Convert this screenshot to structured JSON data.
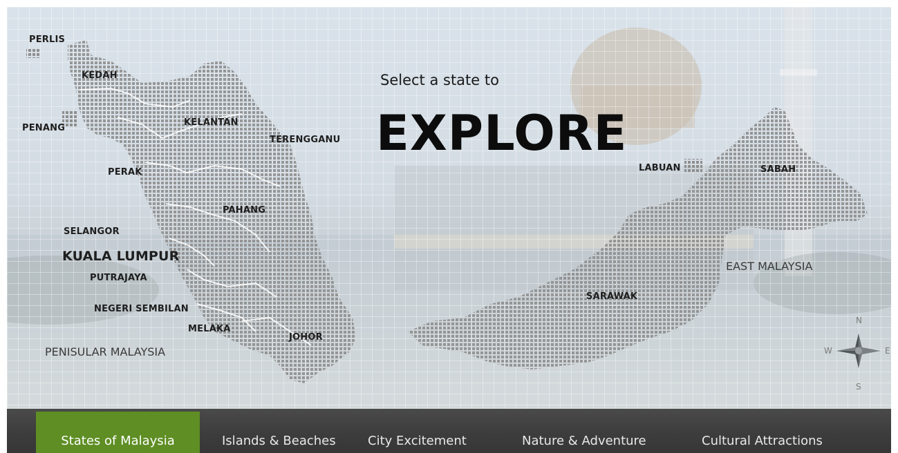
{
  "hero": {
    "subtitle": "Select a state to",
    "title": "EXPLORE"
  },
  "states": {
    "perlis": "PERLIS",
    "kedah": "KEDAH",
    "penang": "PENANG",
    "kelantan": "KELANTAN",
    "terengganu": "TERENGGANU",
    "perak": "PERAK",
    "pahang": "PAHANG",
    "selangor": "SELANGOR",
    "kuala_lumpur": "KUALA LUMPUR",
    "putrajaya": "PUTRAJAYA",
    "negeri_sembilan": "NEGERI SEMBILAN",
    "melaka": "MELAKA",
    "johor": "JOHOR",
    "labuan": "LABUAN",
    "sabah": "SABAH",
    "sarawak": "SARAWAK"
  },
  "regions": {
    "peninsular": "PENISULAR MALAYSIA",
    "east": "EAST MALAYSIA"
  },
  "compass": {
    "n": "N",
    "s": "S",
    "e": "E",
    "w": "W"
  },
  "nav": {
    "items": [
      {
        "label": "States of Malaysia",
        "active": true
      },
      {
        "label": "Islands & Beaches"
      },
      {
        "label": "City Excitement"
      },
      {
        "label": "Nature & Adventure"
      },
      {
        "label": "Cultural Attractions"
      }
    ]
  },
  "colors": {
    "nav_active": "#5e8e24",
    "nav_bg": "#3e3e3e",
    "map_dots": "#8a8a8a"
  }
}
